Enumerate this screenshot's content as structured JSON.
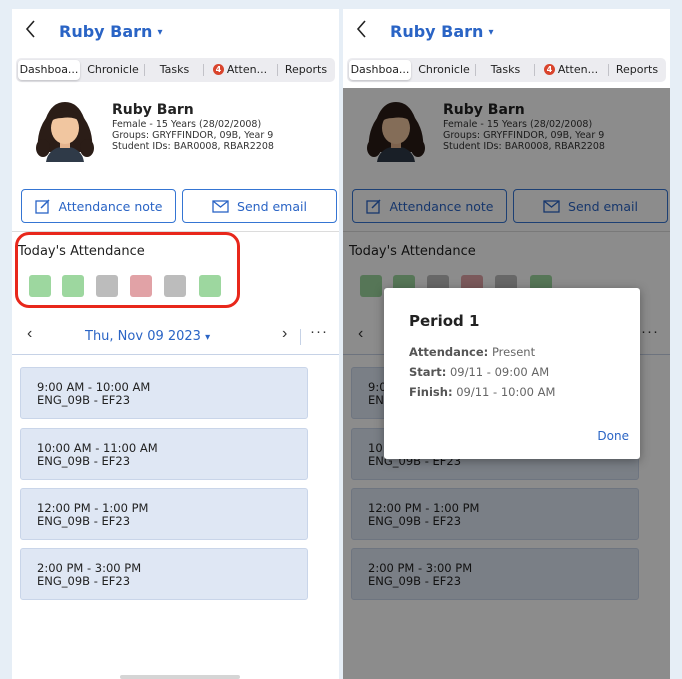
{
  "colors": {
    "accent": "#2a64c5",
    "present": "#9dd79f",
    "unknown": "#bcbcbc",
    "absent": "#e1a2a6",
    "highlight": "#e8271b"
  },
  "header": {
    "back_icon": "chevron-left-icon",
    "title": "Ruby Barn",
    "title_caret": "▾"
  },
  "tabs": [
    {
      "label": "Dashboa..."
    },
    {
      "label": "Chronicle"
    },
    {
      "label": "Tasks"
    },
    {
      "label": "Atten...",
      "badge": "4"
    },
    {
      "label": "Reports"
    }
  ],
  "student": {
    "name": "Ruby  Barn",
    "line1": "Female - 15 Years (28/02/2008)",
    "line2": "Groups: GRYFFINDOR, 09B, Year 9",
    "line3": "Student IDs: BAR0008, RBAR2208"
  },
  "actions": {
    "attendance_note": "Attendance note",
    "send_email": "Send email"
  },
  "attendance": {
    "title": "Today's Attendance",
    "marks": [
      "present",
      "present",
      "unknown",
      "absent",
      "unknown",
      "present"
    ]
  },
  "date_nav": {
    "prev": "‹",
    "date": "Thu, Nov 09 2023",
    "caret": "▾",
    "next": "›",
    "more": "···"
  },
  "periods": [
    {
      "time": "9:00 AM - 10:00 AM",
      "room": "ENG_09B - EF23"
    },
    {
      "time": "10:00 AM - 11:00 AM",
      "room": "ENG_09B - EF23"
    },
    {
      "time": "12:00 PM - 1:00 PM",
      "room": "ENG_09B - EF23"
    },
    {
      "time": "2:00 PM - 3:00 PM",
      "room": "ENG_09B - EF23"
    }
  ],
  "dialog": {
    "title": "Period 1",
    "attendance_label": "Attendance:",
    "attendance_value": "Present",
    "start_label": "Start:",
    "start_value": "09/11 - 09:00 AM",
    "finish_label": "Finish:",
    "finish_value": "09/11 - 10:00 AM",
    "done": "Done"
  }
}
